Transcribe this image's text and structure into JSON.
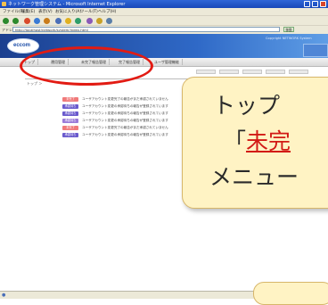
{
  "window": {
    "title": "ネットワーク管理システム - Microsoft Internet Explorer",
    "controls": [
      "minimize",
      "maximize",
      "close"
    ]
  },
  "menubar": {
    "items": [
      "ファイル(F)",
      "編集(E)",
      "表示(V)",
      "お気に入り(A)",
      "ツール(T)",
      "ヘルプ(H)"
    ]
  },
  "toolbar": {
    "icons": [
      "back-icon",
      "forward-icon",
      "stop-icon",
      "refresh-icon",
      "home-icon",
      "search-icon",
      "favorites-icon",
      "media-icon",
      "history-icon",
      "mail-icon",
      "print-icon"
    ],
    "colors": [
      "#2d8a2d",
      "#2d8a2d",
      "#d94b2b",
      "#3a7bd5",
      "#c97c1a",
      "#4a6fb8",
      "#e0b020",
      "#2f9e6a",
      "#8a5ab8",
      "#c9a227",
      "#5a7ea8"
    ]
  },
  "addressbar": {
    "label": "アドレス",
    "url": "http://localhost/network/system/index.html",
    "go_label": "移動"
  },
  "header": {
    "logo_text": "eccom",
    "right_text": "Copyright NETWORK System"
  },
  "nav": {
    "tabs": [
      "トップ",
      "運用管理",
      "未完了報告管理",
      "完了報告管理",
      "ユーザ管理機能"
    ]
  },
  "content": {
    "breadcrumb": "トップ ＞",
    "rows": [
      {
        "badge": "未完了",
        "color": "#f07a7a",
        "text": "ユーザアカウント変更完了の報告がまだ承認されていません"
      },
      {
        "badge": "承認待ち",
        "color": "#6a5acd",
        "text": "ユーザアカウント変更の承認待ちの報告が登録されています"
      },
      {
        "badge": "承認待ち",
        "color": "#6a5acd",
        "text": "ユーザアカウント変更の承認待ちの報告が登録されています"
      },
      {
        "badge": "承認待ち",
        "color": "#9a7ad8",
        "text": "ユーザアカウント変更の承認待ちの報告が登録されています"
      },
      {
        "badge": "未完了",
        "color": "#f07a7a",
        "text": "ユーザアカウント変更完了の報告がまだ承認されていません"
      },
      {
        "badge": "承認待ち",
        "color": "#6a5acd",
        "text": "ユーザアカウント変更の承認待ちの報告が登録されています"
      }
    ]
  },
  "callout": {
    "line1": "トップ",
    "line2_prefix": "「",
    "line2_emph": "未完",
    "line3": "メニュー"
  },
  "accent": {
    "highlight_color": "#e21b13",
    "callout_bg": "#fff3c4"
  }
}
